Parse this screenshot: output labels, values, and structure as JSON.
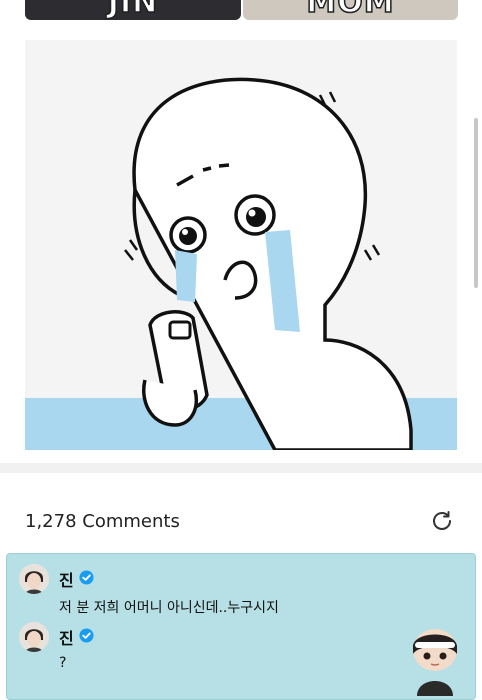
{
  "top_images": {
    "left_label": "JIN",
    "right_label": "MOM"
  },
  "meme": {
    "description_icon": "crying-cartoon-character-holding-phone"
  },
  "comments_header": {
    "count_label": "1,278 Comments",
    "refresh_icon": "refresh-icon"
  },
  "comments": [
    {
      "author": "진",
      "verified": true,
      "text": "저 분 저희 어머니 아니신데..누구시지"
    },
    {
      "author": "진",
      "verified": true,
      "text": "?"
    }
  ],
  "colors": {
    "highlight": "#b6e0e6",
    "verified": "#1a9cf0",
    "tears": "#a9d7f0"
  }
}
